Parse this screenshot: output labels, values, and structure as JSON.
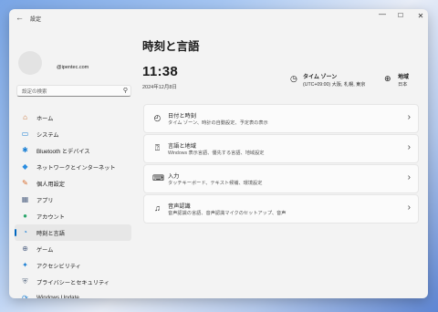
{
  "window": {
    "title": "設定",
    "back_icon": "←",
    "minimize_icon": "—",
    "maximize_icon": "☐",
    "close_icon": "✕"
  },
  "account": {
    "email": "@ipentec.com"
  },
  "search": {
    "placeholder": "設定の検索",
    "icon": "⚲"
  },
  "sidebar": {
    "items": [
      {
        "label": "ホーム",
        "icon": "⌂",
        "color": "#c46a2b"
      },
      {
        "label": "システム",
        "icon": "▭",
        "color": "#1a7fd4"
      },
      {
        "label": "Bluetooth とデバイス",
        "icon": "✱",
        "color": "#1a7fd4"
      },
      {
        "label": "ネットワークとインターネット",
        "icon": "◆",
        "color": "#2a8de0"
      },
      {
        "label": "個人用設定",
        "icon": "✎",
        "color": "#d86a2a"
      },
      {
        "label": "アプリ",
        "icon": "▦",
        "color": "#5a6b8a"
      },
      {
        "label": "アカウント",
        "icon": "●",
        "color": "#2aa56a"
      },
      {
        "label": "時刻と言語",
        "icon": "◔",
        "color": "#1a7fd4"
      },
      {
        "label": "ゲーム",
        "icon": "⊕",
        "color": "#5a6b8a"
      },
      {
        "label": "アクセシビリティ",
        "icon": "✦",
        "color": "#1a7fd4"
      },
      {
        "label": "プライバシーとセキュリティ",
        "icon": "⛨",
        "color": "#6b7a8f"
      },
      {
        "label": "Windows Update",
        "icon": "⟳",
        "color": "#1a7fd4"
      }
    ],
    "active_index": 7
  },
  "main": {
    "title": "時刻と言語",
    "time": "11:38",
    "date": "2024年12月8日",
    "timezone": {
      "icon": "◷",
      "title": "タイム ゾーン",
      "value": "(UTC+09:00) 大阪, 札幌, 東京"
    },
    "region": {
      "icon": "⊕",
      "title": "地域",
      "value": "日本"
    },
    "cards": [
      {
        "icon": "◴",
        "title": "日付と時刻",
        "subtitle": "タイム ゾーン、時計の自動設定、予定表の表示",
        "chevron": "›"
      },
      {
        "icon": "⍰",
        "title": "言語と地域",
        "subtitle": "Windows 表示言語、優先する言語、地域設定",
        "chevron": "›"
      },
      {
        "icon": "⌨",
        "title": "入力",
        "subtitle": "タッチキーボード、テキスト候補、環境設定",
        "chevron": "›"
      },
      {
        "icon": "♫",
        "title": "音声認識",
        "subtitle": "音声認識の言語、音声認識マイクのセットアップ、音声",
        "chevron": "›"
      }
    ]
  }
}
